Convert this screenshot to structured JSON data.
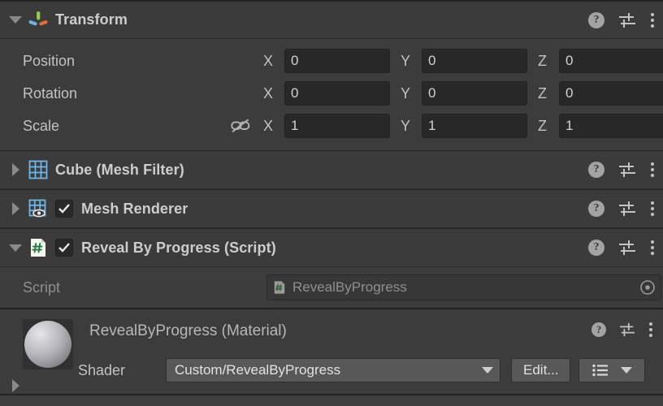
{
  "colors": {
    "panel_bg": "#3c3c3c",
    "header_bg": "#3b3b3b",
    "field_bg": "#282828",
    "button_bg": "#585858",
    "text": "#c2c2c2",
    "text_dim": "#8f8f8f",
    "axis_green": "#8fce4e",
    "axis_blue": "#6fb2e0",
    "axis_red": "#e06c45",
    "mesh_blue": "#6fb5e8",
    "script_green": "#1f7a3a"
  },
  "transform": {
    "title": "Transform",
    "icon": "transform-axis-icon",
    "expanded": true,
    "rows": [
      {
        "label": "Position",
        "has_link": false,
        "link_icon": "",
        "fields": [
          {
            "axis": "X",
            "value": "0"
          },
          {
            "axis": "Y",
            "value": "0"
          },
          {
            "axis": "Z",
            "value": "0"
          }
        ]
      },
      {
        "label": "Rotation",
        "has_link": false,
        "link_icon": "",
        "fields": [
          {
            "axis": "X",
            "value": "0"
          },
          {
            "axis": "Y",
            "value": "0"
          },
          {
            "axis": "Z",
            "value": "0"
          }
        ]
      },
      {
        "label": "Scale",
        "has_link": true,
        "link_icon": "broken-link-icon",
        "fields": [
          {
            "axis": "X",
            "value": "1"
          },
          {
            "axis": "Y",
            "value": "1"
          },
          {
            "axis": "Z",
            "value": "1"
          }
        ]
      }
    ]
  },
  "components": [
    {
      "title": "Cube (Mesh Filter)",
      "icon": "mesh-filter-icon",
      "expanded": false,
      "has_checkbox": false,
      "checked": false
    },
    {
      "title": "Mesh Renderer",
      "icon": "mesh-renderer-icon",
      "expanded": false,
      "has_checkbox": true,
      "checked": true
    },
    {
      "title": "Reveal By Progress (Script)",
      "icon": "csharp-script-icon",
      "expanded": true,
      "has_checkbox": true,
      "checked": true
    }
  ],
  "script_property": {
    "label": "Script",
    "value": "RevealByProgress",
    "value_icon": "csharp-script-icon",
    "picker_icon": "object-picker-icon"
  },
  "material": {
    "title": "RevealByProgress (Material)",
    "preview_icon": "material-sphere-preview",
    "shader_label": "Shader",
    "shader_value": "Custom/RevealByProgress",
    "edit_button": "Edit...",
    "preset_icon": "shader-preset-list-icon",
    "expanded": false
  },
  "header_actions": {
    "help": "help-icon",
    "preset": "preset-sliders-icon",
    "menu": "kebab-menu-icon"
  }
}
